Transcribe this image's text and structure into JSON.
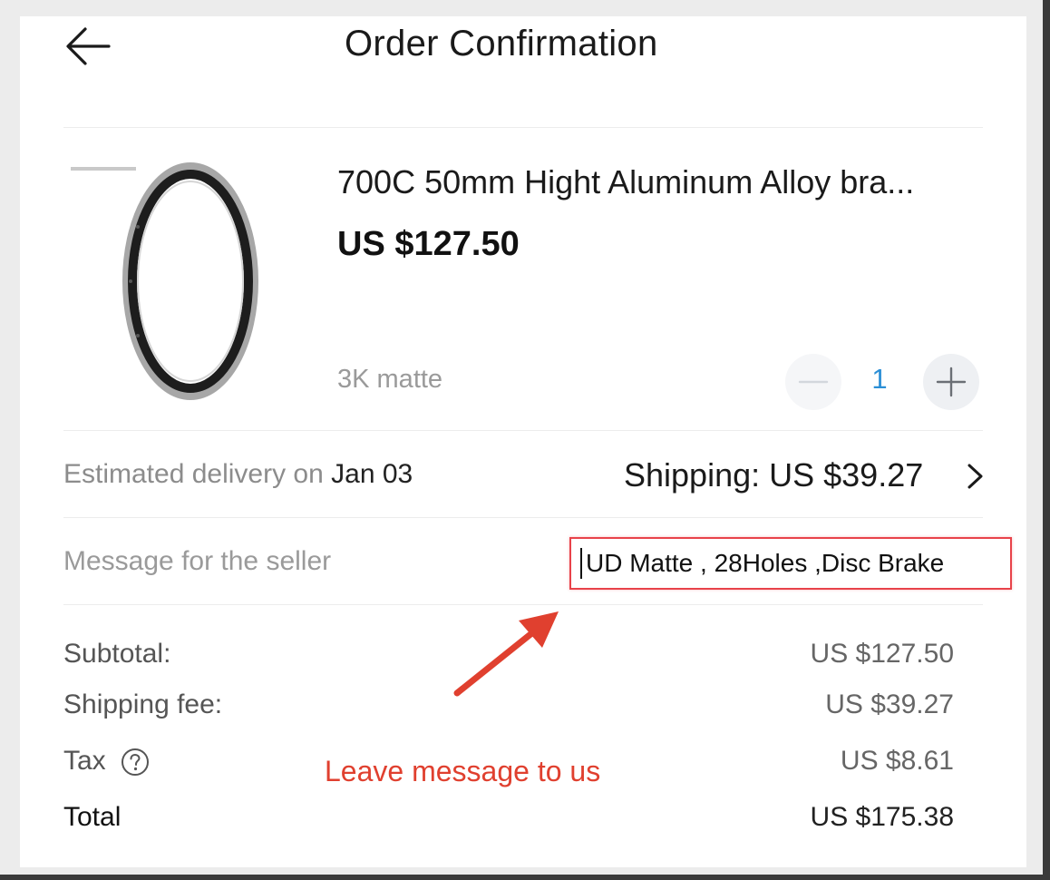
{
  "header": {
    "title": "Order Confirmation",
    "back_icon": "back-arrow-icon"
  },
  "product": {
    "title": "700C 50mm Hight Aluminum Alloy bra...",
    "price": "US $127.50",
    "variant": "3K matte",
    "quantity": "1",
    "image_icon": "bicycle-rim-image"
  },
  "delivery": {
    "label": "Estimated delivery on",
    "date": "Jan 03",
    "shipping": "Shipping: US $39.27"
  },
  "message": {
    "label": "Message for the seller",
    "value": "UD Matte , 28Holes ,Disc Brake"
  },
  "annotation": {
    "text": "Leave message to us",
    "color": "#e0402f"
  },
  "summary": {
    "subtotal_label": "Subtotal:",
    "subtotal_value": "US $127.50",
    "shipping_label": "Shipping fee:",
    "shipping_value": "US $39.27",
    "tax_label": "Tax",
    "tax_value": "US $8.61",
    "total_label": "Total",
    "total_value": "US $175.38"
  },
  "colors": {
    "accent_blue": "#2b8fd6",
    "highlight_red": "#e8434a"
  }
}
